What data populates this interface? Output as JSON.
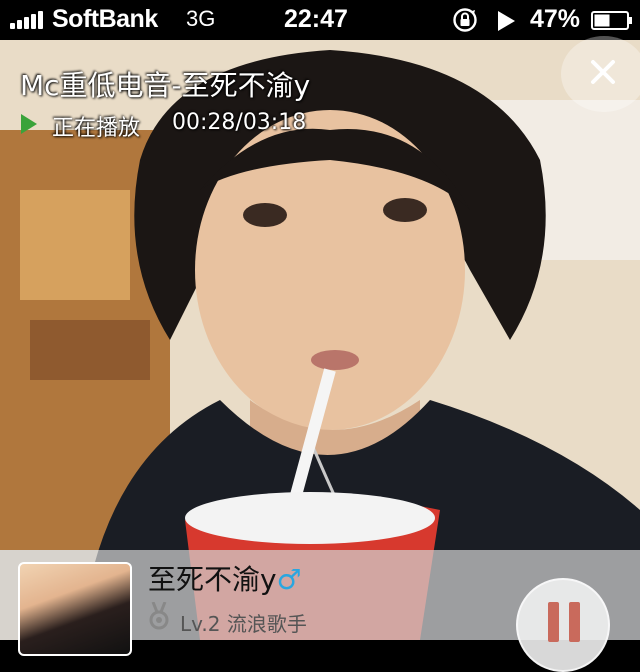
{
  "status_bar": {
    "carrier": "SoftBank",
    "network": "3G",
    "time": "22:47",
    "battery": "47%",
    "icons": [
      "signal-icon",
      "rotation-lock-icon",
      "play-icon",
      "battery-icon"
    ]
  },
  "player": {
    "title": "Mc重低电音-至死不渝y",
    "status_label": "正在播放",
    "time": "00:28/03:18",
    "progress": 0.141,
    "artist": "至死不渝y",
    "gender_symbol": "♂",
    "level": "Lv.2 流浪歌手",
    "icons": [
      "close-icon",
      "play-triangle-icon",
      "medal-icon",
      "pause-icon"
    ]
  },
  "colors": {
    "play_icon": "#3aa33a",
    "gender": "#2aa6e0",
    "pause": "#c96a5c"
  }
}
